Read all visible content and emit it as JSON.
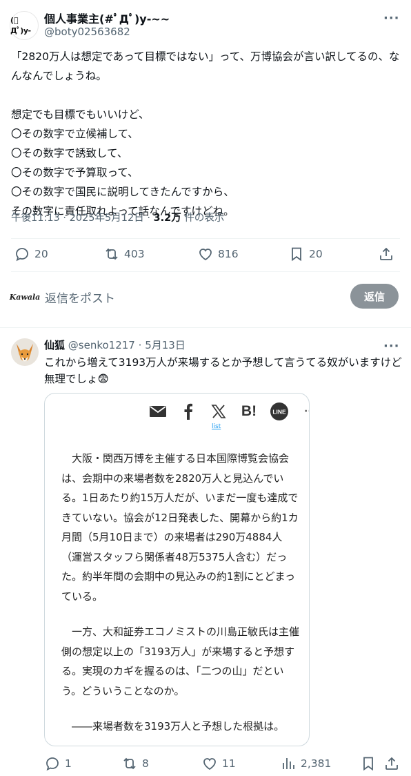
{
  "post": {
    "avatar_text": "(ﾟДﾟ)y-",
    "display_name": "個人事業主(#ﾟДﾟ)y-~~",
    "handle": "@boty02563682",
    "more": "···",
    "body": "「2820万人は想定であって目標ではない」って、万博協会が言い訳してるの、なんなんでしょうね。\n\n想定でも目標でもいいけど、\n〇その数字で立候補して、\n〇その数字で誘致して、\n〇その数字で予算取って、\n〇その数字で国民に説明してきたんですから、\nその数字に責任取れよって話なんですけどね。",
    "time": "午後11:13",
    "date": "2025年5月12日",
    "views": "3.2万",
    "views_label": "件の表示",
    "separator": "·",
    "actions": {
      "reply": "20",
      "repost": "403",
      "like": "816",
      "bookmark": "20"
    }
  },
  "composer": {
    "avatar_text": "Kawala",
    "placeholder": "返信をポスト",
    "button": "返信"
  },
  "reply": {
    "name": "仙狐",
    "handle": "@senko1217",
    "date": "5月13日",
    "separator": "·",
    "more": "···",
    "text": "これから増えて3193万人が来場するとか予想して言うてる奴がいますけど無理でしょ😨",
    "card": {
      "share_icons": [
        "mail-icon",
        "facebook-icon",
        "x-icon",
        "hatena-icon",
        "line-icon"
      ],
      "hatena": "B!",
      "line": "LINE",
      "more": "···",
      "list_link": "list",
      "paragraphs": [
        "大阪・関西万博を主催する日本国際博覧会協会は、会期中の来場者数を2820万人と見込んでいる。1日あたり約15万人だが、いまだ一度も達成できていない。協会が12日発表した、開幕から約1カ月間（5月10日まで）の来場者は290万4884人（運営スタッフら関係者48万5375人含む）だった。約半年間の会期中の見込みの約1割にとどまっている。",
        "一方、大和証券エコノミストの川島正敏氏は主催側の想定以上の「3193万人」が来場すると予想する。実現のカギを握るのは、「二つの山」だという。どういうことなのか。",
        "――来場者数を3193万人と予想した根拠は。"
      ]
    },
    "actions": {
      "reply": "1",
      "repost": "8",
      "like": "11",
      "views": "2,381"
    }
  },
  "colors": {
    "text": "#0f1419",
    "muted": "#536471",
    "link": "#1d9bf0",
    "button_disabled": "#8b9399"
  }
}
